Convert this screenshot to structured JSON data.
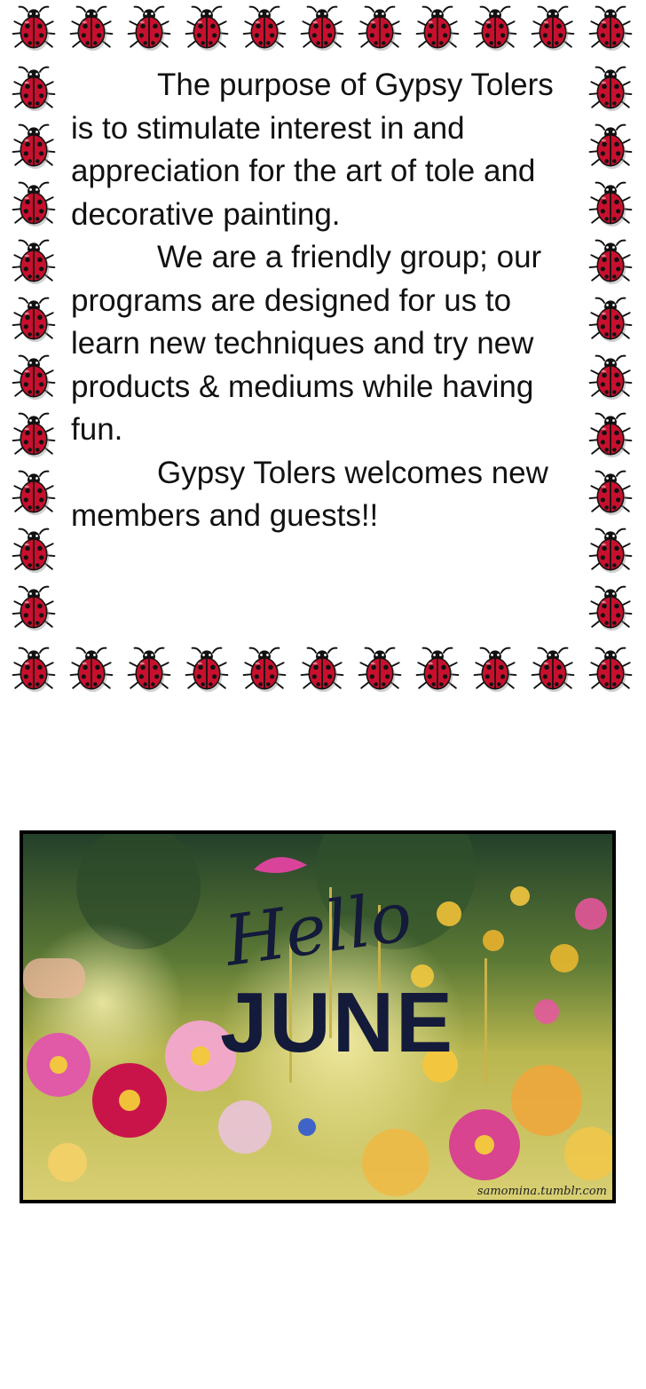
{
  "purpose": {
    "paragraphs": [
      "The purpose of Gypsy Tolers is to stimulate interest in and appreciation for the art of tole and decorative painting.",
      "We are a friendly group; our programs are designed for us to learn new techniques and try new products & mediums while having fun.",
      "Gypsy Tolers welcomes new members and guests!!"
    ]
  },
  "photo": {
    "greeting_script": "Hello",
    "greeting_month": "JUNE",
    "watermark": "samomina.tumblr.com"
  },
  "border": {
    "icon": "ladybug-icon",
    "shell_color": "#c8102e",
    "spot_color": "#111111"
  }
}
